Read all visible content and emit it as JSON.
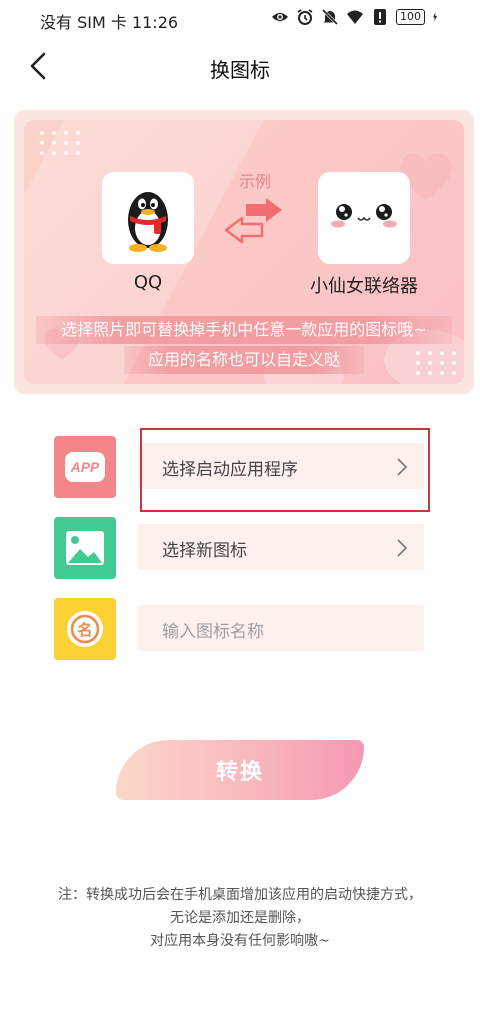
{
  "status_bar": {
    "carrier_time": "没有 SIM 卡 11:26",
    "battery": "100",
    "icons": [
      "eye-icon",
      "alarm-icon",
      "mute-icon",
      "wifi-icon",
      "sim-alert-icon",
      "battery-icon",
      "charging-icon"
    ]
  },
  "header": {
    "title": "换图标",
    "back_icon": "back-chevron-icon"
  },
  "banner": {
    "example_label": "示例",
    "source_app": {
      "name": "QQ",
      "icon": "qq-penguin-icon"
    },
    "target_app": {
      "name": "小仙女联络器",
      "icon": "cute-face-icon"
    },
    "swap_icon": "swap-arrows-icon",
    "desc_line1": "选择照片即可替换掉手机中任意一款应用的图标哦~",
    "desc_line2": "应用的名称也可以自定义哒"
  },
  "options": {
    "app_select": {
      "label": "选择启动应用程序",
      "icon": "app-icon"
    },
    "icon_select": {
      "label": "选择新图标",
      "icon": "image-icon"
    },
    "name_input": {
      "placeholder": "输入图标名称",
      "icon": "name-icon"
    }
  },
  "convert_button": {
    "label": "转换"
  },
  "note": {
    "line1": "注：转换成功后会在手机桌面增加该应用的启动快捷方式，",
    "line2": "无论是添加还是删除，",
    "line3": "对应用本身没有任何影响嗷~"
  },
  "colors": {
    "accent_pink": "#f3858b",
    "green": "#3fcb91",
    "yellow": "#fbd233",
    "highlight_red": "#c9353b"
  }
}
